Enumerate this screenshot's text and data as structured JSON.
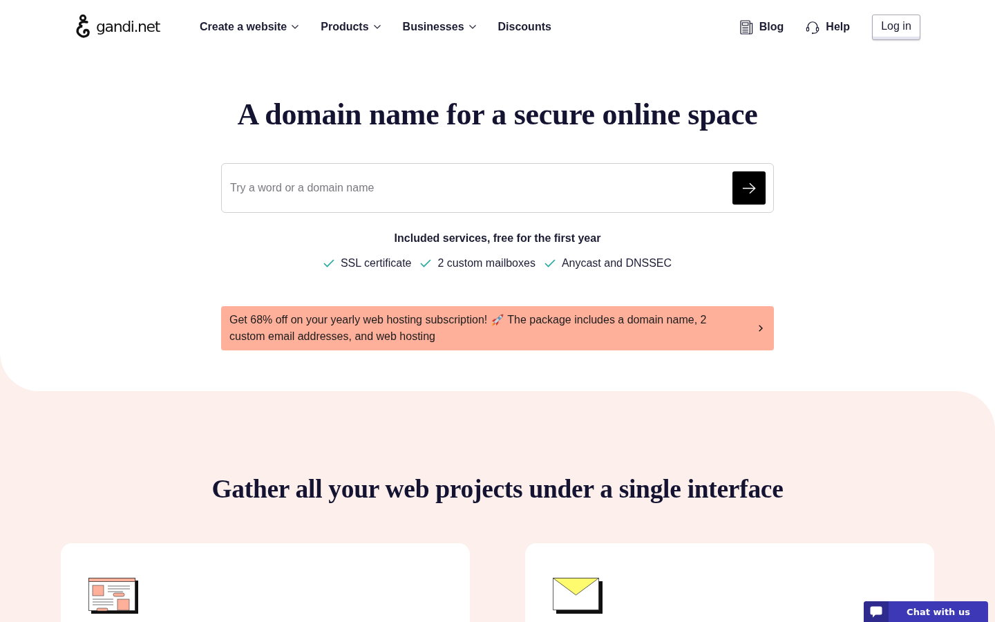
{
  "header": {
    "logo": {
      "text": "gandi.net"
    },
    "nav": [
      {
        "label": "Create a website",
        "dropdown": true
      },
      {
        "label": "Products",
        "dropdown": true
      },
      {
        "label": "Businesses",
        "dropdown": true
      },
      {
        "label": "Discounts",
        "dropdown": false
      }
    ],
    "blog_link": {
      "label": "Blog"
    },
    "help_link": {
      "label": "Help"
    },
    "login_button": {
      "label": "Log in"
    }
  },
  "hero": {
    "title": "A domain name for a secure online space",
    "search": {
      "placeholder": "Try a word or a domain name"
    },
    "included_title": "Included services, free for the first year",
    "included": [
      "SSL certificate",
      "2 custom mailboxes",
      "Anycast and DNSSEC"
    ],
    "promo": {
      "lead": "Get 68% off on your yearly web hosting subscription!",
      "lines": [
        "The package includes a domain name, 2",
        "custom email addresses, and web hosting"
      ]
    }
  },
  "features": {
    "title": "Gather all your web projects under a single interface",
    "cards": [
      {
        "kind": "website"
      },
      {
        "kind": "email"
      }
    ]
  },
  "chat_widget": {
    "label": "Chat with us"
  }
}
